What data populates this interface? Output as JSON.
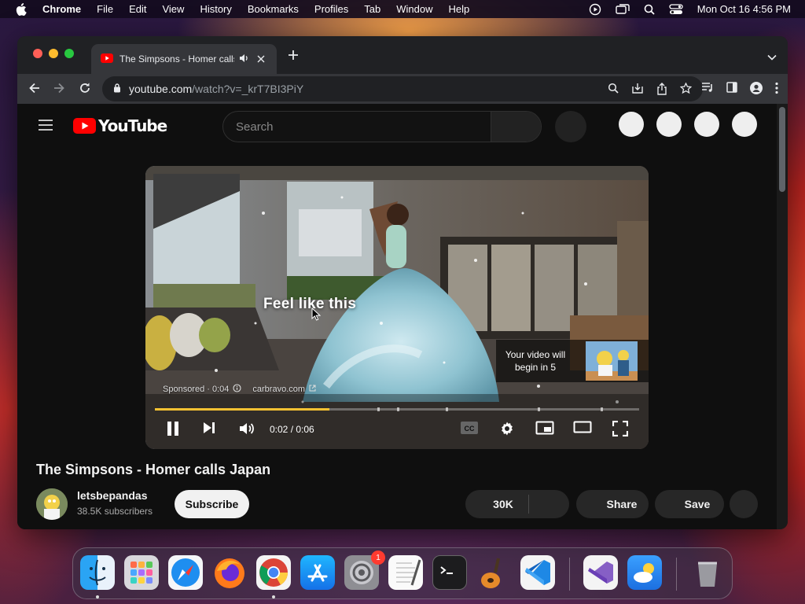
{
  "menubar": {
    "app_name": "Chrome",
    "items": [
      "File",
      "Edit",
      "View",
      "History",
      "Bookmarks",
      "Profiles",
      "Tab",
      "Window",
      "Help"
    ],
    "datetime": "Mon Oct 16  4:56 PM"
  },
  "browser": {
    "tab_title": "The Simpsons - Homer calls Japan - YouTube",
    "url_host": "youtube.com",
    "url_path": "/watch?v=_krT7BI3PiY"
  },
  "youtube": {
    "logo_text": "YouTube",
    "search_placeholder": "Search",
    "player": {
      "caption": "Feel like this",
      "sponsored": "Sponsored · 0:04",
      "ad_domain": "carbravo.com",
      "skip_text": "Your video will begin in 5",
      "time": "0:02 / 0:06",
      "progress_fraction": 0.36,
      "ad_markers": [
        0.46,
        0.5,
        0.6,
        0.79,
        0.92
      ]
    },
    "video_title": "The Simpsons - Homer calls Japan",
    "channel": {
      "name": "letsbepandas",
      "subscribers": "38.5K subscribers",
      "subscribe_label": "Subscribe"
    },
    "actions": {
      "like_count": "30K",
      "share_label": "Share",
      "save_label": "Save"
    }
  },
  "dock": {
    "apps": [
      "Finder",
      "Launchpad",
      "Safari",
      "Firefox",
      "Google Chrome",
      "App Store",
      "System Settings",
      "TextEdit",
      "Terminal",
      "GarageBand",
      "Visual Studio Code",
      "Visual Studio",
      "Weather",
      "Trash"
    ],
    "settings_badge": "1"
  },
  "colors": {
    "yt_red": "#ff0000",
    "progress": "#f7c232",
    "page_bg": "#0f0f0f"
  }
}
